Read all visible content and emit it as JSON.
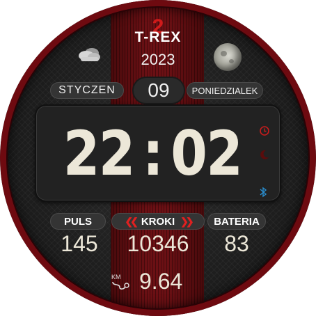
{
  "brand": {
    "name": "T-REX",
    "badge": "2",
    "year": "2023"
  },
  "date": {
    "month": "STYCZEN",
    "day": "09",
    "weekday": "PONIEDZIALEK"
  },
  "time": {
    "hours": "22",
    "separator": ":",
    "minutes": "02"
  },
  "stats": {
    "pulse_label": "PULS",
    "pulse_value": "145",
    "steps_label": "KROKI",
    "steps_value": "10346",
    "steps_chevrons_left": "❮❮",
    "steps_chevrons_right": "❯❯",
    "battery_label": "BATERIA",
    "battery_value": "83"
  },
  "distance": {
    "unit_icon_text": "KM",
    "value": "9.64"
  },
  "icons": {
    "weather": "cloudy-weather-icon",
    "moon": "moon-phase-icon",
    "alarm": "alarm-icon",
    "night": "night-mode-icon",
    "bluetooth": "bluetooth-icon",
    "distance": "distance-icon"
  },
  "colors": {
    "accent": "#d01b1b",
    "stripe": "#6b1014",
    "bezel": "#6e0a10",
    "digits": "#ece7d8"
  }
}
